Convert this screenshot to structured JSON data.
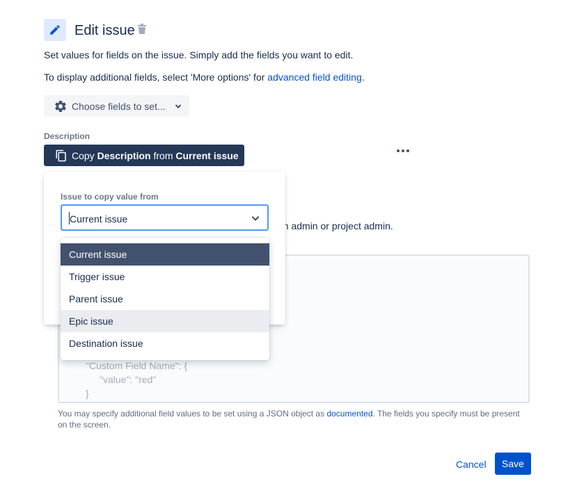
{
  "header": {
    "title": "Edit issue",
    "icon": "pencil-icon",
    "delete_icon": "trash-icon"
  },
  "intro": {
    "line1": "Set values for fields on the issue. Simply add the fields you want to edit.",
    "line2_prefix": "To display additional fields, select 'More options' for ",
    "line2_link": "advanced field editing",
    "line2_suffix": "."
  },
  "choose_fields": {
    "label": "Choose fields to set...",
    "icon": "gear-icon",
    "caret": "chevron-down-icon"
  },
  "description": {
    "label": "Description",
    "copy_prefix": "Copy ",
    "copy_field": "Description",
    "copy_from": " from ",
    "copy_source": "Current issue",
    "copy_icon": "copy-icon",
    "more_icon": "more-dots-icon"
  },
  "background_text": "an admin or project admin.",
  "popup": {
    "label": "Issue to copy value from",
    "select_value": "Current issue"
  },
  "dropdown": {
    "options": [
      "Current issue",
      "Trigger issue",
      "Parent issue",
      "Epic issue",
      "Destination issue"
    ],
    "selected_index": 0,
    "hover_index": 3
  },
  "json_editor": {
    "line1": "\"Custom Field Name\": {",
    "line2": "\"value\": \"red\"",
    "line3": "}"
  },
  "helper": {
    "prefix": "You may specify additional field values to be set using a JSON object as ",
    "link": "documented",
    "suffix": ". The fields you specify must be present on the screen."
  },
  "footer": {
    "cancel_label": "Cancel",
    "save_label": "Save"
  },
  "colors": {
    "primary": "#0052cc",
    "dark_bar": "#253858",
    "selected_option": "#42526e",
    "focus_border": "#4c9aff",
    "icon_bg": "#deebff"
  }
}
